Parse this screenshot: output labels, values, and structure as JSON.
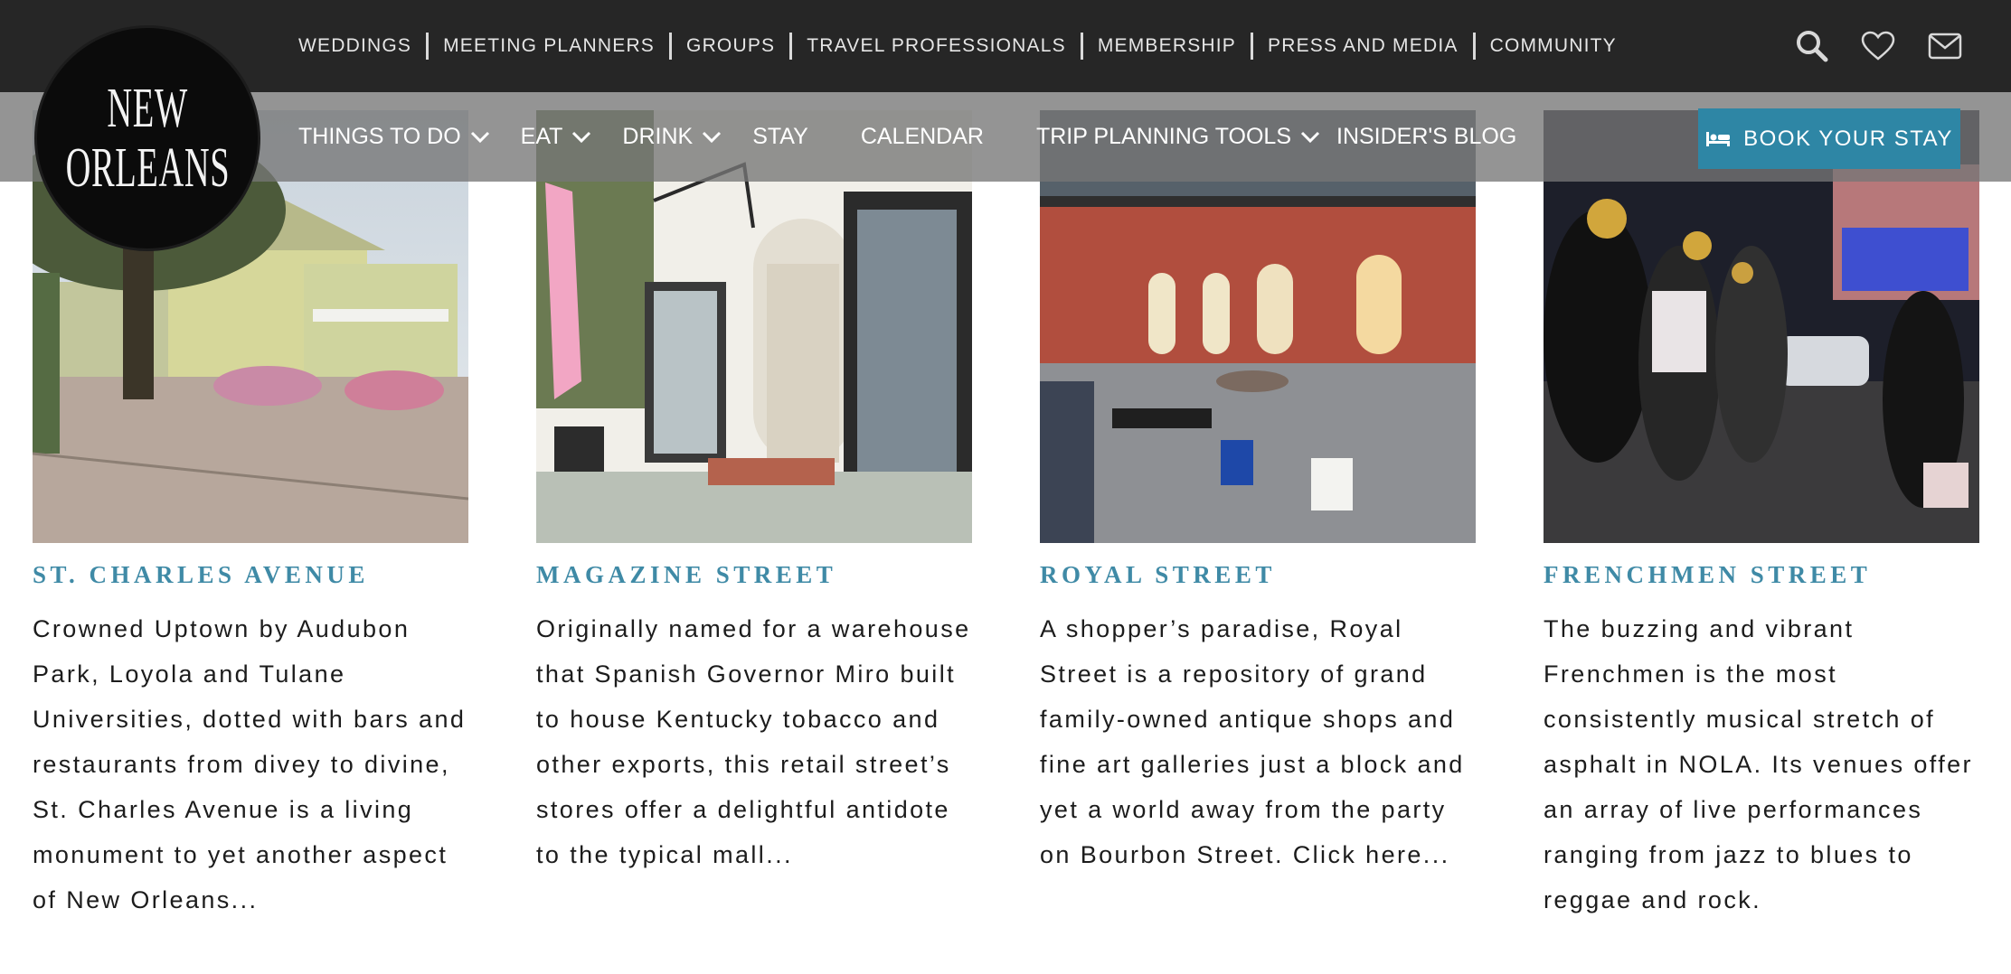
{
  "logo": {
    "line1": "NEW",
    "line2": "ORLEANS"
  },
  "utility_nav": [
    {
      "label": "WEDDINGS"
    },
    {
      "label": "MEETING PLANNERS"
    },
    {
      "label": "GROUPS"
    },
    {
      "label": "TRAVEL PROFESSIONALS"
    },
    {
      "label": "MEMBERSHIP"
    },
    {
      "label": "PRESS AND MEDIA"
    },
    {
      "label": "COMMUNITY"
    }
  ],
  "top_icons": [
    "search-icon",
    "heart-icon",
    "mail-icon"
  ],
  "main_nav": [
    {
      "label": "THINGS TO DO",
      "dropdown": true
    },
    {
      "label": "EAT",
      "dropdown": true
    },
    {
      "label": "DRINK",
      "dropdown": true
    },
    {
      "label": "STAY",
      "dropdown": false
    },
    {
      "label": "CALENDAR",
      "dropdown": false
    },
    {
      "label": "TRIP PLANNING TOOLS",
      "dropdown": true
    },
    {
      "label": "INSIDER'S BLOG",
      "dropdown": false
    }
  ],
  "book_button": {
    "label": "BOOK YOUR STAY",
    "icon": "bed-icon"
  },
  "colors": {
    "topbar": "#262626",
    "accent": "#2e86a5",
    "card_title": "#3f8aa6",
    "body_text": "#1c1c1c"
  },
  "cards": [
    {
      "title": "ST. CHARLES AVENUE",
      "description": "Crowned Uptown by Audubon Park, Loyola and Tulane Universities, dotted with bars and restaurants from divey to divine, St. Charles Avenue is a living monument to yet another aspect of New Orleans...",
      "image": "st-charles-avenue-photo"
    },
    {
      "title": "MAGAZINE STREET",
      "description": "Originally named for a warehouse that Spanish Governor Miro built to house Kentucky tobacco and other exports, this retail street’s stores offer a delightful antidote to the typical mall...",
      "image": "magazine-street-photo"
    },
    {
      "title": "ROYAL STREET",
      "description": "A shopper’s paradise, Royal Street is a repository of grand family-owned antique shops and fine art galleries just a block and yet a world away from the party on Bourbon Street. Click here...",
      "image": "royal-street-photo"
    },
    {
      "title": "FRENCHMEN STREET",
      "description": "The buzzing and vibrant Frenchmen is the most consistently musical stretch of asphalt in NOLA. Its venues offer an array of live performances ranging from jazz to blues to reggae and rock.",
      "image": "frenchmen-street-photo"
    }
  ]
}
